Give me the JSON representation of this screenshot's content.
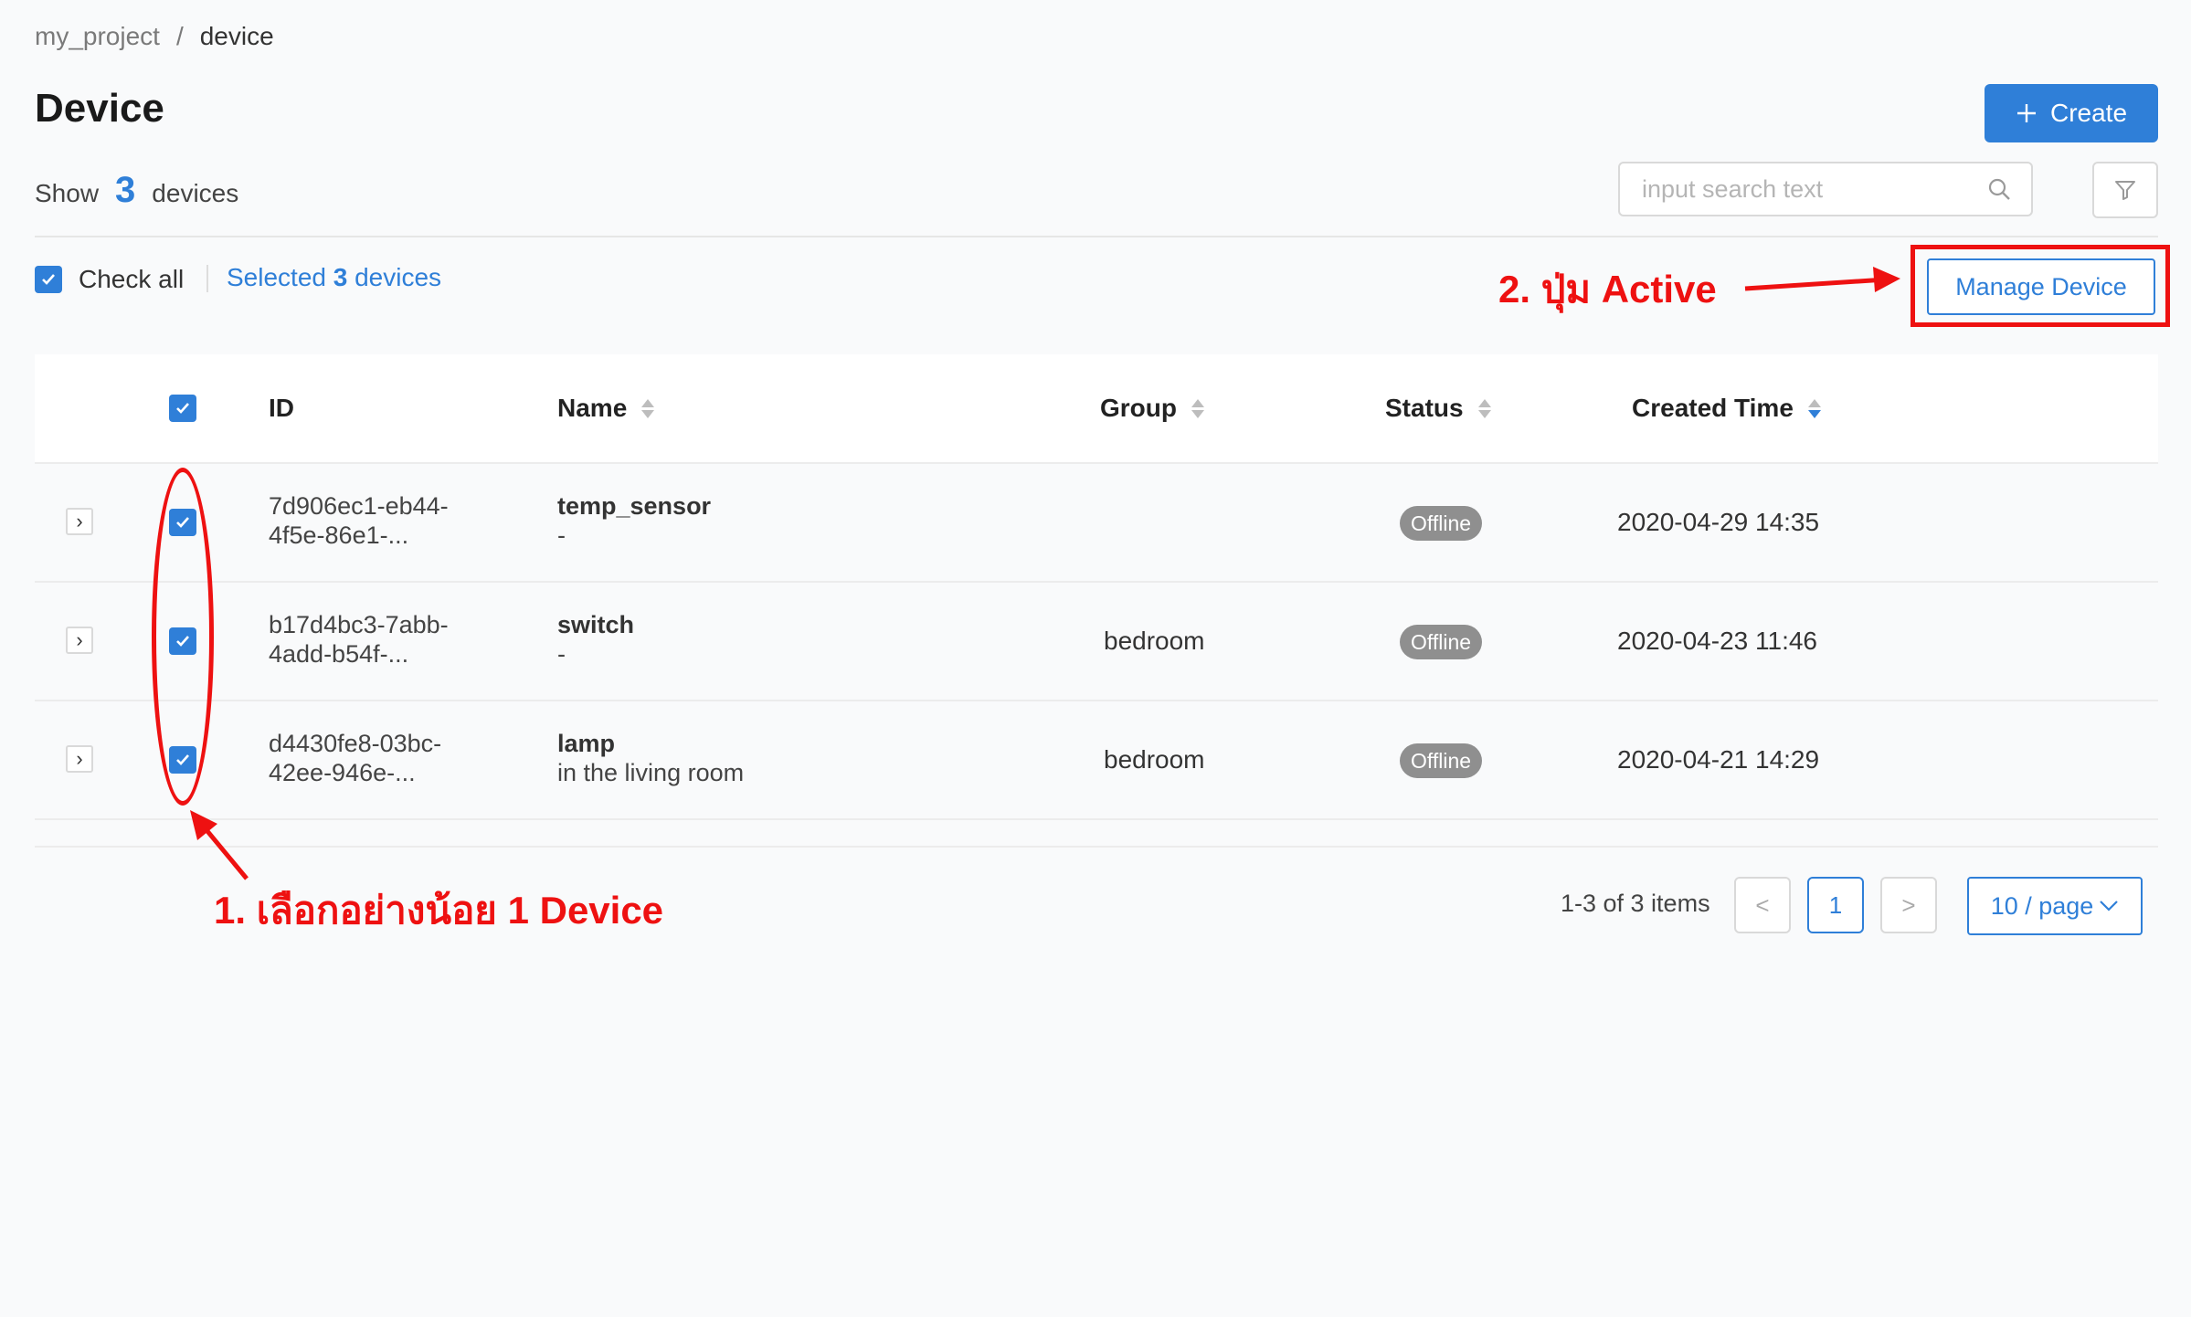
{
  "breadcrumb": {
    "project": "my_project",
    "separator": "/",
    "current": "device"
  },
  "page": {
    "title": "Device",
    "show_label": "Show",
    "device_count": "3",
    "devices_label": "devices"
  },
  "toolbar": {
    "create_label": "Create",
    "search_placeholder": "input search text",
    "check_all_label": "Check all",
    "selected_prefix": "Selected",
    "selected_count": "3",
    "selected_suffix": "devices",
    "manage_label": "Manage Device"
  },
  "table": {
    "columns": {
      "id": "ID",
      "name": "Name",
      "group": "Group",
      "status": "Status",
      "created": "Created Time"
    },
    "rows": [
      {
        "id_line1": "7d906ec1-eb44-",
        "id_line2": "4f5e-86e1-...",
        "name": "temp_sensor",
        "description": "-",
        "group": "",
        "status": "Offline",
        "created": "2020-04-29 14:35",
        "checked": true
      },
      {
        "id_line1": "b17d4bc3-7abb-",
        "id_line2": "4add-b54f-...",
        "name": "switch",
        "description": "-",
        "group": "bedroom",
        "status": "Offline",
        "created": "2020-04-23 11:46",
        "checked": true
      },
      {
        "id_line1": "d4430fe8-03bc-",
        "id_line2": "42ee-946e-...",
        "name": "lamp",
        "description": "in the living room",
        "group": "bedroom",
        "status": "Offline",
        "created": "2020-04-21 14:29",
        "checked": true
      }
    ]
  },
  "pagination": {
    "summary": "1-3 of 3 items",
    "prev": "<",
    "current_page": "1",
    "next": ">",
    "page_size": "10 / page"
  },
  "annotations": {
    "step1": "1. เลือกอย่างน้อย 1 Device",
    "step2": "2. ปุ่ม Active"
  },
  "colors": {
    "accent": "#2f7fd8",
    "annotation": "#ee1111",
    "status_offline": "#8f8f8f"
  }
}
